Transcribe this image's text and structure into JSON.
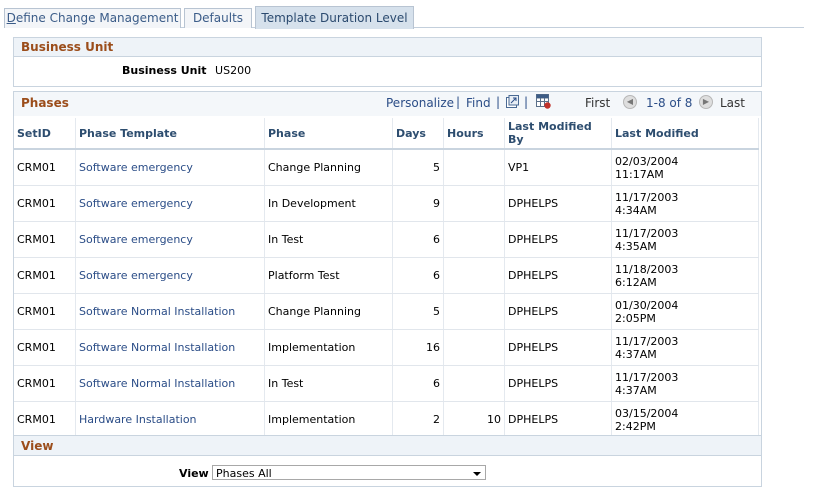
{
  "tabs": [
    {
      "label": "Define Change Management",
      "underline": "D",
      "rest": "efine Change Management"
    },
    {
      "label": "Defaults"
    },
    {
      "label": "Template Duration Level"
    }
  ],
  "business_unit": {
    "section_title": "Business Unit",
    "label": "Business Unit",
    "value": "US200"
  },
  "phases": {
    "section_title": "Phases",
    "toolbar": {
      "personalize": "Personalize",
      "sep": "|",
      "find": "Find",
      "first": "First",
      "range": "1-8 of 8",
      "last": "Last"
    },
    "columns": [
      "SetID",
      "Phase Template",
      "Phase",
      "Days",
      "Hours",
      "Last Modified By",
      "Last Modified"
    ],
    "rows": [
      {
        "setid": "CRM01",
        "template": "Software emergency",
        "phase": "Change Planning",
        "days": "5",
        "hours": "",
        "by": "VP1",
        "date": "02/03/2004",
        "time": "11:17AM"
      },
      {
        "setid": "CRM01",
        "template": "Software emergency",
        "phase": "In Development",
        "days": "9",
        "hours": "",
        "by": "DPHELPS",
        "date": "11/17/2003",
        "time": "4:34AM"
      },
      {
        "setid": "CRM01",
        "template": "Software emergency",
        "phase": "In Test",
        "days": "6",
        "hours": "",
        "by": "DPHELPS",
        "date": "11/17/2003",
        "time": "4:35AM"
      },
      {
        "setid": "CRM01",
        "template": "Software emergency",
        "phase": "Platform Test",
        "days": "6",
        "hours": "",
        "by": "DPHELPS",
        "date": "11/18/2003",
        "time": "6:12AM"
      },
      {
        "setid": "CRM01",
        "template": "Software Normal Installation",
        "phase": "Change Planning",
        "days": "5",
        "hours": "",
        "by": "DPHELPS",
        "date": "01/30/2004",
        "time": "2:05PM"
      },
      {
        "setid": "CRM01",
        "template": "Software Normal Installation",
        "phase": "Implementation",
        "days": "16",
        "hours": "",
        "by": "DPHELPS",
        "date": "11/17/2003",
        "time": "4:37AM"
      },
      {
        "setid": "CRM01",
        "template": "Software Normal Installation",
        "phase": "In Test",
        "days": "6",
        "hours": "",
        "by": "DPHELPS",
        "date": "11/17/2003",
        "time": "4:37AM"
      },
      {
        "setid": "CRM01",
        "template": "Hardware Installation",
        "phase": "Implementation",
        "days": "2",
        "hours": "10",
        "by": "DPHELPS",
        "date": "03/15/2004",
        "time": "2:42PM"
      }
    ]
  },
  "view": {
    "section_title": "View",
    "label": "View",
    "selected": "Phases All"
  }
}
